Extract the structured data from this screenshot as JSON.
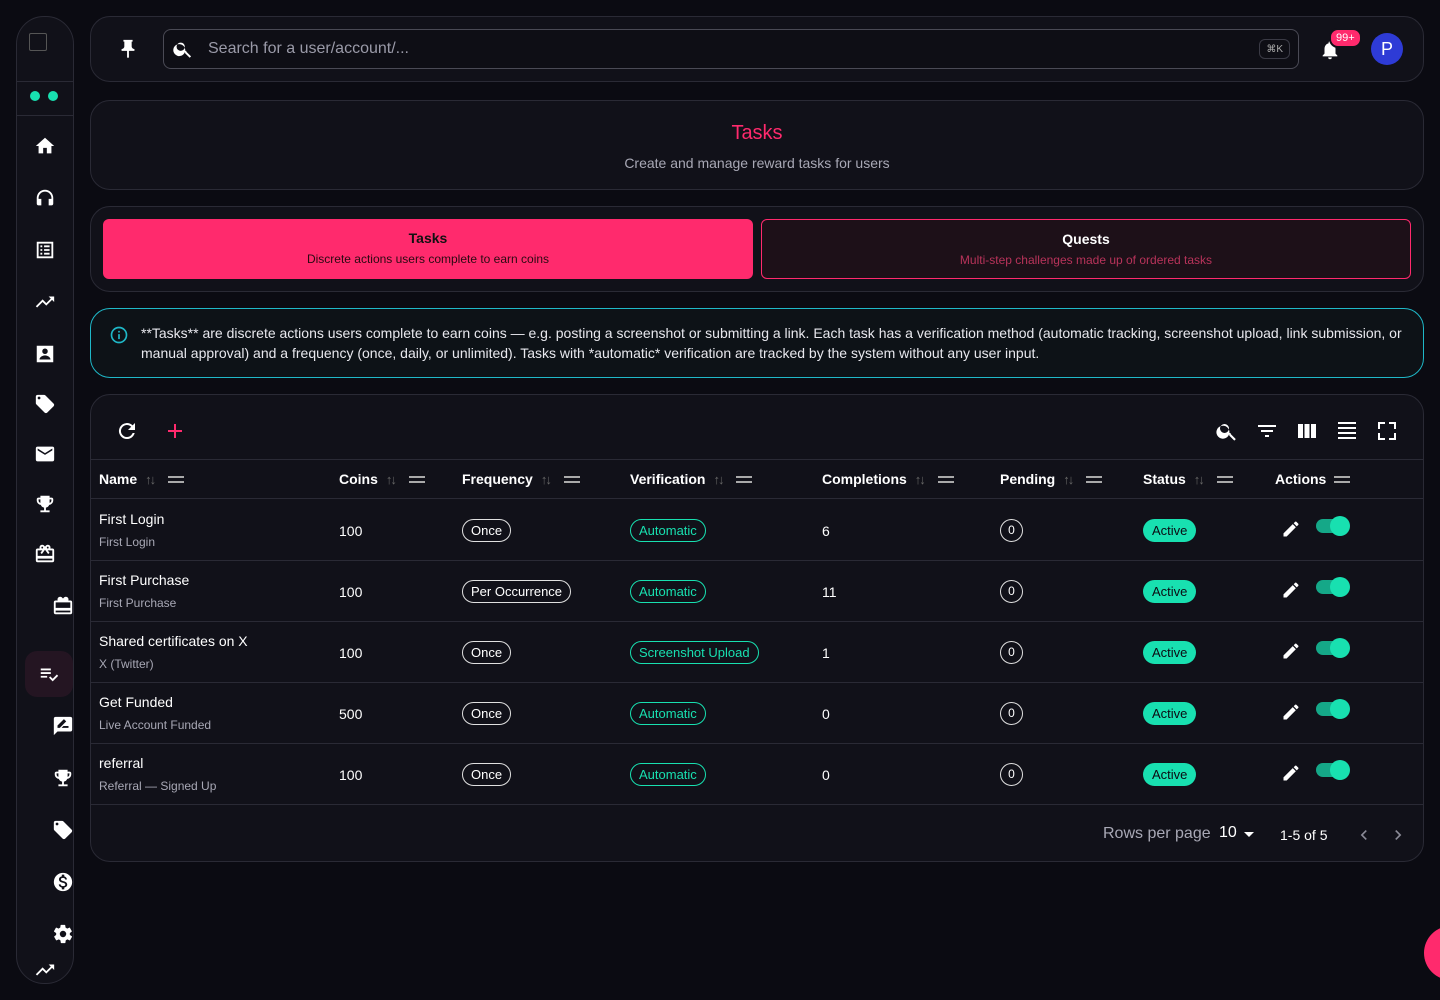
{
  "topbar": {
    "search_placeholder": "Search for a user/account/...",
    "shortcut": "⌘K",
    "notifications_badge": "99+",
    "avatar_initial": "P"
  },
  "header": {
    "title": "Tasks",
    "subtitle": "Create and manage reward tasks for users"
  },
  "tabs": [
    {
      "title": "Tasks",
      "subtitle": "Discrete actions users complete to earn coins",
      "selected": true
    },
    {
      "title": "Quests",
      "subtitle": "Multi-step challenges made up of ordered tasks",
      "selected": false
    }
  ],
  "info": {
    "text": "**Tasks** are discrete actions users complete to earn coins — e.g. posting a screenshot or submitting a link. Each task has a verification method (automatic tracking, screenshot upload, link submission, or manual approval) and a frequency (once, daily, or unlimited). Tasks with *automatic* verification are tracked by the system without any user input."
  },
  "table": {
    "columns": [
      "Name",
      "Coins",
      "Frequency",
      "Verification",
      "Completions",
      "Pending",
      "Status",
      "Actions"
    ],
    "rows": [
      {
        "name": "First Login",
        "sub": "First Login",
        "coins": "100",
        "frequency": "Once",
        "verification": "Automatic",
        "completions": "6",
        "pending": "0",
        "status": "Active"
      },
      {
        "name": "First Purchase",
        "sub": "First Purchase",
        "coins": "100",
        "frequency": "Per Occurrence",
        "verification": "Automatic",
        "completions": "11",
        "pending": "0",
        "status": "Active"
      },
      {
        "name": "Shared certificates on X",
        "sub": "X (Twitter)",
        "coins": "100",
        "frequency": "Once",
        "verification": "Screenshot Upload",
        "completions": "1",
        "pending": "0",
        "status": "Active"
      },
      {
        "name": "Get Funded",
        "sub": "Live Account Funded",
        "coins": "500",
        "frequency": "Once",
        "verification": "Automatic",
        "completions": "0",
        "pending": "0",
        "status": "Active"
      },
      {
        "name": "referral",
        "sub": "Referral — Signed Up",
        "coins": "100",
        "frequency": "Once",
        "verification": "Automatic",
        "completions": "0",
        "pending": "0",
        "status": "Active"
      }
    ]
  },
  "pagination": {
    "rows_per_page_label": "Rows per page",
    "rows_per_page": "10",
    "range": "1-5 of 5"
  },
  "colors": {
    "accent": "#ff2a6d",
    "teal": "#18e0b0",
    "info": "#1fb8c8",
    "background": "#0b0b12"
  },
  "icons": {
    "sidebar": [
      "home-icon",
      "headset-icon",
      "list-alt-icon",
      "trending-up-icon",
      "contact-card-icon",
      "tag-icon",
      "mail-icon",
      "trophy-icon",
      "gift-card-icon",
      "redeem-icon",
      "playlist-check-icon",
      "rate-review-icon",
      "trophy-icon",
      "tag-icon",
      "dollar-icon",
      "settings-icon",
      "trending-up-icon"
    ]
  }
}
